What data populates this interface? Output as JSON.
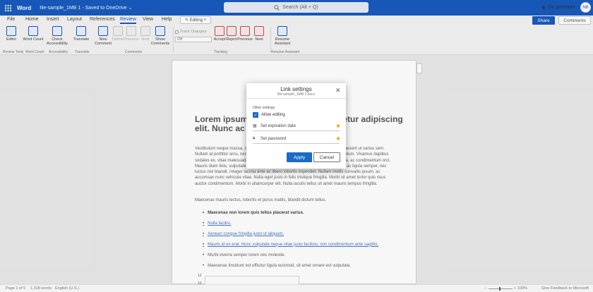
{
  "titlebar": {
    "app_name": "Word",
    "doc_title": "file-sample_1MB 1  -  Saved to OneDrive ⌄",
    "search_placeholder": "Search (Alt + Q)",
    "premium_label": "Go premium",
    "avatar_initials": "NB"
  },
  "menu": {
    "tabs": [
      "File",
      "Home",
      "Insert",
      "Layout",
      "References",
      "Review",
      "View",
      "Help"
    ],
    "active_tab": "Review",
    "editing_label": "✎ Editing ˅",
    "share_label": "Share",
    "comments_label": "Comments"
  },
  "ribbon": {
    "buttons": {
      "editor": "Editor",
      "word_count": "Word Count",
      "check_accessibility": "Check Accessibility",
      "translate": "Translate",
      "new_comment": "New Comment",
      "delete": "Delete",
      "previous": "Previous",
      "next": "Next",
      "show_comments": "Show Comments",
      "accept": "Accept",
      "reject": "Reject",
      "previous2": "Previous",
      "next2": "Next",
      "resume_assistant": "Resume Assistant"
    },
    "track_changes_label": "Track Changes",
    "track_select_value": "Off",
    "groups": {
      "review_tools": "Review Tools",
      "word_count": "Word Count",
      "accessibility": "Accessibility",
      "translate": "Translate",
      "comments": "Comments",
      "tracking": "Tracking",
      "resume_assistant": "Resume Assistant"
    }
  },
  "document": {
    "heading": "Lorem ipsum dolor sit amet, consectetur adipiscing elit. Nunc ac faucibus odio.",
    "paragraph1": "Vestibulum neque massa, scelerisque sit amet ligula eu, congue molestie mi. Praesent ut varius sem. Nullam at porttitor arcu, nec lacinia nisi. Ut ac dolor vitae odio interdum condimentum. Vivamus dapibus sodales ex, vitae malesuada ipsum cursus convallis. Maecenas sed egestas nulla, ac condimentum orci. Mauris diam felis, vulputate ac suscipit et, iaculis non est. Curabitur semper arcu ac ligula semper, nec luctus nisl blandit. Integer lacinia ante ac libero lobortis imperdiet. Nullam mollis convallis ipsum, ac accumsan nunc vehicula vitae. Nulla eget justo in felis tristique fringilla. Morbi sit amet tortor quis risus auctor condimentum. Morbi in ullamcorper elit. Nulla iaculis tellus sit amet mauris tempus fringilla.",
    "paragraph2": "Maecenas mauris lectus, lobortis et purus mattis, blandit dictum tellus.",
    "list": [
      "Maecenas non lorem quis tellus placerat varius.",
      "Nulla facilisi.",
      "Aenean congue fringilla justo ut aliquam.",
      "Mauris id ex erat. Nunc vulputate neque vitae justo facilisis, non condimentum ante sagittis.",
      "Morbi viverra semper lorem nec molestie.",
      "Maecenas tincidunt est efficitur ligula euismod, sit amet ornare est vulputate."
    ],
    "chart_axis": [
      "12",
      "10"
    ]
  },
  "modal": {
    "title": "Link settings",
    "subtitle": "file-sample_1MB 1.docx",
    "other_settings_label": "Other settings",
    "allow_editing_label": "Allow editing",
    "allow_editing_checked": true,
    "expiration_label": "Set expiration date",
    "password_label": "Set password",
    "apply_label": "Apply",
    "cancel_label": "Cancel"
  },
  "statusbar": {
    "page": "Page 1 of 5",
    "words": "1,318 words",
    "language": "English (U.S.)",
    "zoom": "100%",
    "feedback": "Give Feedback to Microsoft"
  },
  "colors": {
    "brand": "#185abd",
    "accent_button": "#1a6ac6",
    "plus": "#e2a000"
  }
}
